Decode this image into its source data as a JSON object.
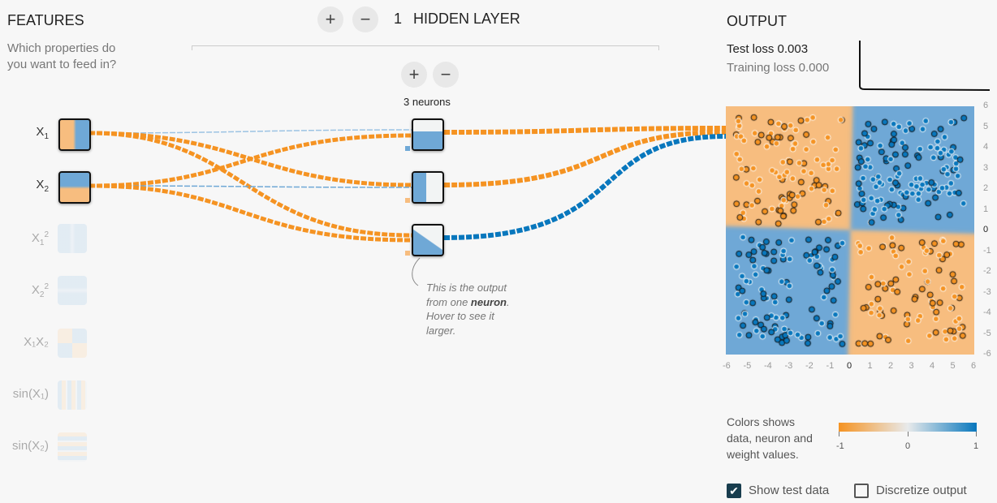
{
  "features": {
    "title": "FEATURES",
    "subtitle_line1": "Which properties do",
    "subtitle_line2": "you want to feed in?",
    "items": [
      {
        "label": "X",
        "sub": "1",
        "sup": "",
        "active": true
      },
      {
        "label": "X",
        "sub": "2",
        "sup": "",
        "active": true
      },
      {
        "label": "X",
        "sub": "1",
        "sup": "2",
        "active": false
      },
      {
        "label": "X",
        "sub": "2",
        "sup": "2",
        "active": false
      },
      {
        "label": "X₁X₂",
        "sub": "",
        "sup": "",
        "active": false
      },
      {
        "label": "sin(X₁)",
        "sub": "",
        "sup": "",
        "active": false
      },
      {
        "label": "sin(X₂)",
        "sub": "",
        "sup": "",
        "active": false
      }
    ]
  },
  "layers": {
    "add_icon": "plus-icon",
    "remove_icon": "minus-icon",
    "plus": "+",
    "minus": "−",
    "count": "1",
    "title": "HIDDEN LAYER",
    "neurons_label": "3 neurons"
  },
  "tooltip": {
    "part1": "This is the output",
    "part2": "from one ",
    "bold": "neuron",
    "part3": ".",
    "part4": "Hover to see it",
    "part5": "larger."
  },
  "output": {
    "title": "OUTPUT",
    "test_loss_label": "Test loss ",
    "test_loss": "0.003",
    "training_loss_label": "Training loss ",
    "training_loss": "0.000",
    "x_ticks": [
      "-6",
      "-5",
      "-4",
      "-3",
      "-2",
      "-1",
      "0",
      "1",
      "2",
      "3",
      "4",
      "5",
      "6"
    ],
    "y_ticks": [
      "6",
      "5",
      "4",
      "3",
      "2",
      "1",
      "0",
      "-1",
      "-2",
      "-3",
      "-4",
      "-5",
      "-6"
    ]
  },
  "legend": {
    "line1": "Colors shows",
    "line2": "data, neuron and",
    "line3": "weight values.",
    "min": "-1",
    "mid": "0",
    "max": "1"
  },
  "options": {
    "show_test_data": "Show test data",
    "show_test_data_checked": true,
    "discretize": "Discretize output",
    "discretize_checked": false
  },
  "colors": {
    "orange": "#f59322",
    "blue": "#0877bd",
    "light_orange": "#f7bd7f",
    "light_blue": "#6fa8d6"
  }
}
